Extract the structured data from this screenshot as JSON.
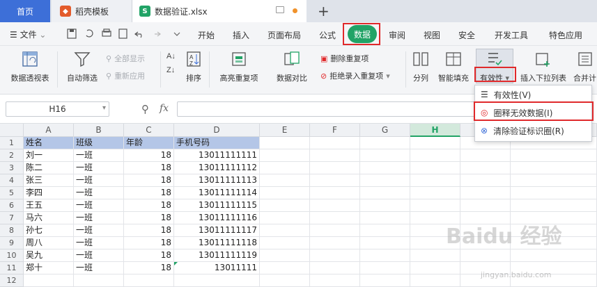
{
  "tabs": {
    "home": "首页",
    "templates": "稻壳模板",
    "file": "数据验证.xlsx",
    "new_tab": "+"
  },
  "menu": {
    "file": "文件",
    "items": [
      "开始",
      "插入",
      "页面布局",
      "公式",
      "数据",
      "审阅",
      "视图",
      "安全",
      "开发工具",
      "特色应用"
    ],
    "active": "数据"
  },
  "ribbon": {
    "pivot": "数据透视表",
    "autofilter": "自动筛选",
    "show_all": "全部显示",
    "reapply": "重新应用",
    "sort": "排序",
    "highlight_dup": "高亮重复项",
    "compare": "数据对比",
    "remove_dup": "删除重复项",
    "reject_dup": "拒绝录入重复项",
    "split": "分列",
    "smart_fill": "智能填充",
    "validity": "有效性",
    "insert_dropdown": "插入下拉列表",
    "merge_calc": "合并计"
  },
  "dropdown": {
    "items": [
      "有效性(V)",
      "圈释无效数据(I)",
      "清除验证标识圈(R)"
    ]
  },
  "formula": {
    "cell_ref": "H16",
    "fx": "fx"
  },
  "sheet": {
    "columns": [
      "A",
      "B",
      "C",
      "D",
      "E",
      "F",
      "G",
      "H"
    ],
    "rows": [
      [
        "姓名",
        "班级",
        "年龄",
        "手机号码"
      ],
      [
        "刘一",
        "一班",
        "18",
        "13011111111"
      ],
      [
        "陈二",
        "一班",
        "18",
        "13011111112"
      ],
      [
        "张三",
        "一班",
        "18",
        "13011111113"
      ],
      [
        "李四",
        "一班",
        "18",
        "13011111114"
      ],
      [
        "王五",
        "一班",
        "18",
        "13011111115"
      ],
      [
        "马六",
        "一班",
        "18",
        "13011111116"
      ],
      [
        "孙七",
        "一班",
        "18",
        "13011111117"
      ],
      [
        "周八",
        "一班",
        "18",
        "13011111118"
      ],
      [
        "吴九",
        "一班",
        "18",
        "13011111119"
      ],
      [
        "郑十",
        "一班",
        "18",
        "13011111"
      ],
      [
        "",
        "",
        "",
        ""
      ]
    ],
    "active_column": "H"
  },
  "watermark": {
    "text": "Baidu 经验",
    "sub": "jingyan.baidu.com"
  },
  "colors": {
    "accent_green": "#21a366",
    "header_fill": "#b4c6e7",
    "highlight_red": "#e0292b",
    "tab_blue": "#3d6fd8"
  }
}
